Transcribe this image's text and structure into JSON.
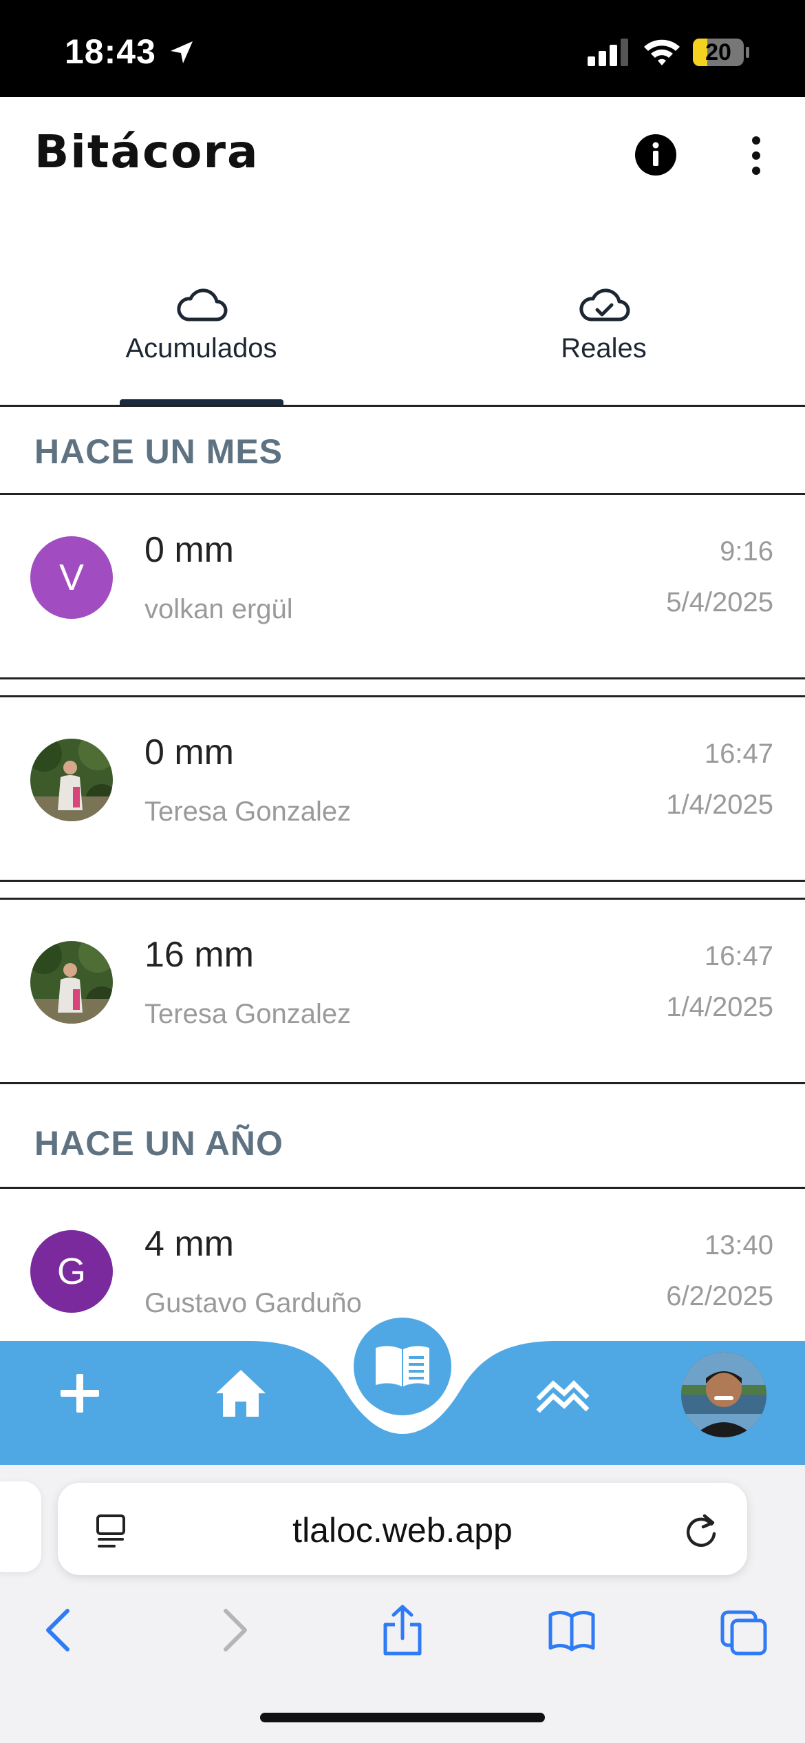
{
  "status_bar": {
    "time": "18:43",
    "battery": "20"
  },
  "header": {
    "title": "Bitácora"
  },
  "tabs": [
    {
      "label": "Acumulados",
      "icon": "cloud-icon",
      "selected": true
    },
    {
      "label": "Reales",
      "icon": "cloud-check-icon",
      "selected": false
    }
  ],
  "sections": [
    {
      "title": "HACE UN MES",
      "entries": [
        {
          "amount": "0 mm",
          "author": "volkan ergül",
          "time": "9:16",
          "date": "5/4/2025",
          "avatar_letter": "V",
          "avatar_color": "#a14cc0"
        },
        {
          "amount": "0 mm",
          "author": "Teresa Gonzalez",
          "time": "16:47",
          "date": "1/4/2025",
          "avatar_photo": true
        },
        {
          "amount": "16 mm",
          "author": "Teresa Gonzalez",
          "time": "16:47",
          "date": "1/4/2025",
          "avatar_photo": true
        }
      ]
    },
    {
      "title": "HACE UN AÑO",
      "entries": [
        {
          "amount": "4 mm",
          "author": "Gustavo Garduño",
          "time": "13:40",
          "date": "6/2/2025",
          "avatar_letter": "G",
          "avatar_color": "#7a2a9c"
        }
      ]
    }
  ],
  "bottom_nav": {
    "accent": "#4fa8e4",
    "items": [
      "add-icon",
      "home-icon",
      "book-icon",
      "trend-icon",
      "profile-avatar"
    ]
  },
  "browser": {
    "url": "tlaloc.web.app"
  }
}
